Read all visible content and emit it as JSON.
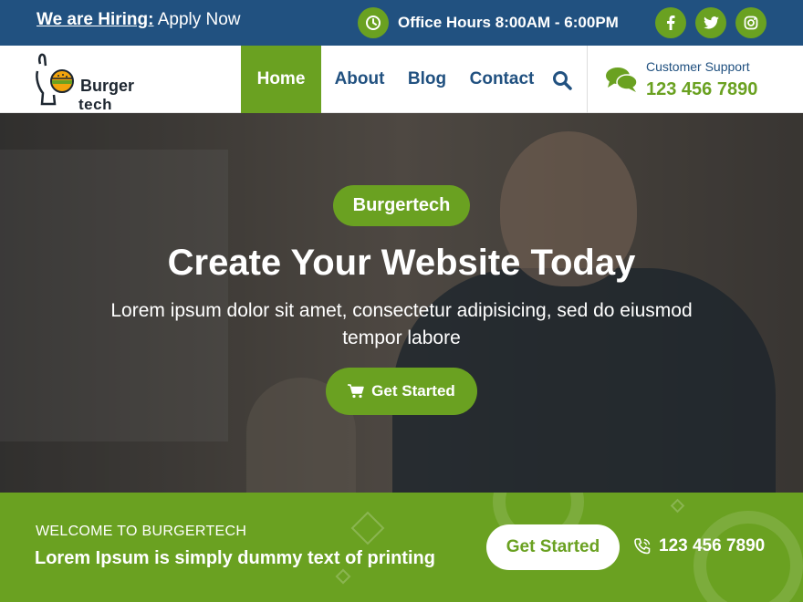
{
  "topbar": {
    "hiring_label": "We are Hiring:",
    "hiring_link": "Apply Now",
    "office_hours": "Office Hours 8:00AM - 6:00PM",
    "social": [
      "facebook-icon",
      "twitter-icon",
      "instagram-icon"
    ]
  },
  "header": {
    "logo_line1": "Burger",
    "logo_line2": "tech",
    "nav": [
      "Home",
      "About",
      "Blog",
      "Contact"
    ],
    "active_nav": "Home",
    "support_label": "Customer Support",
    "support_phone": "123 456 7890"
  },
  "hero": {
    "badge": "Burgertech",
    "title": "Create Your Website Today",
    "subtitle": "Lorem ipsum dolor sit amet, consectetur adipisicing, sed do eiusmod tempor labore",
    "button": "Get Started"
  },
  "band": {
    "welcome": "WELCOME TO BURGERTECH",
    "title": "Lorem Ipsum is simply dummy text of printing",
    "button": "Get Started",
    "phone": "123 456 7890"
  },
  "colors": {
    "primary_blue": "#215180",
    "accent_green": "#6aa121",
    "white": "#ffffff"
  }
}
